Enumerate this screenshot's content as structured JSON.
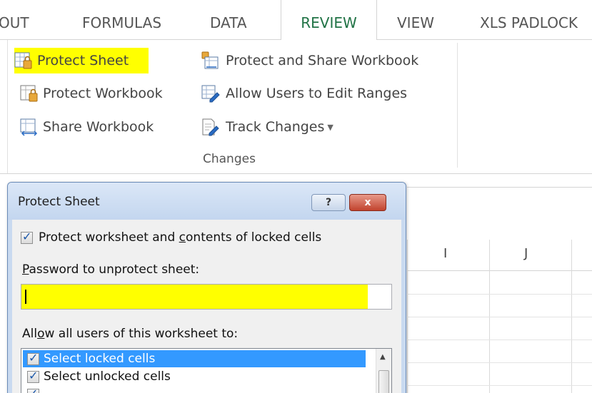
{
  "tabs": [
    {
      "label": "OUT"
    },
    {
      "label": "FORMULAS"
    },
    {
      "label": "DATA"
    },
    {
      "label": "REVIEW"
    },
    {
      "label": "VIEW"
    },
    {
      "label": "XLS PADLOCK"
    }
  ],
  "ribbon": {
    "group_label": "Changes",
    "protect_sheet": "Protect Sheet",
    "protect_workbook": "Protect Workbook",
    "share_workbook": "Share Workbook",
    "protect_and_share": "Protect and Share Workbook",
    "allow_users_edit": "Allow Users to Edit Ranges",
    "track_changes": "Track Changes"
  },
  "sheet": {
    "columns": [
      "I",
      "J"
    ]
  },
  "dialog": {
    "title": "Protect Sheet",
    "help_label": "?",
    "close_label": "x",
    "protect_label_pre": "Protect worksheet and ",
    "protect_label_u": "c",
    "protect_label_post": "ontents of locked cells",
    "password_label_u": "P",
    "password_label_post": "assword to unprotect sheet:",
    "password_value": "",
    "allow_label_pre": "All",
    "allow_label_u": "o",
    "allow_label_post": "w all users of this worksheet to:",
    "permissions": [
      {
        "label": "Select locked cells",
        "checked": true,
        "selected": true
      },
      {
        "label": "Select unlocked cells",
        "checked": true,
        "selected": false
      }
    ]
  },
  "colors": {
    "highlight": "#ffff00",
    "review_tab": "#217346",
    "selection": "#3399ff"
  }
}
